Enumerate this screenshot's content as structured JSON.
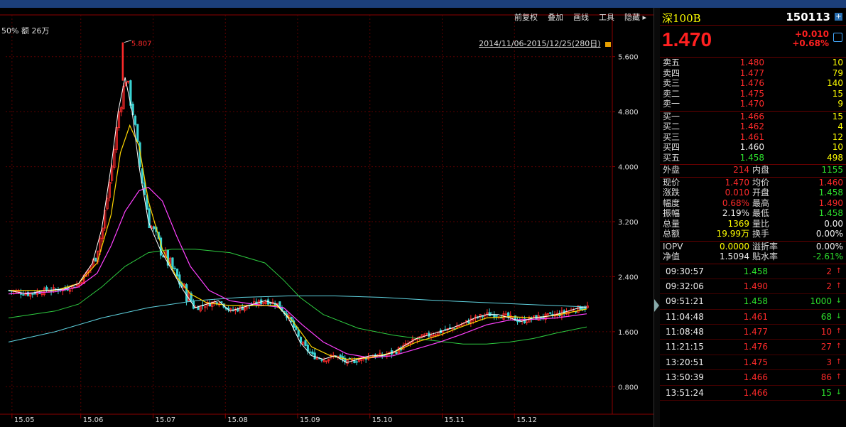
{
  "menu": [
    "前复权",
    "叠加",
    "画线",
    "工具",
    "隐藏 ▸"
  ],
  "info_bar": "50%  额 26万",
  "date_range": "2014/11/06-2015/12/25(280日)",
  "peak_label": "5.807",
  "colors": {
    "up": "#ff2a2a",
    "down": "#39d3d3",
    "ma5": "#ffffff",
    "ma10": "#ffd700",
    "ma20": "#ff40ff",
    "ma60": "#2ecc40",
    "ma120": "#5fd3e0"
  },
  "chart_data": {
    "type": "candlestick",
    "ylim": [
      0.4,
      6.0
    ],
    "y_ticks": [
      "5.600",
      "4.800",
      "4.000",
      "3.200",
      "2.400",
      "1.600",
      "0.800"
    ],
    "x_ticks": [
      "15.05",
      "15.06",
      "15.07",
      "15.08",
      "15.09",
      "15.10",
      "15.11",
      "15.12"
    ],
    "y_tick_values": [
      5.6,
      4.8,
      4.0,
      3.2,
      2.4,
      1.6,
      0.8
    ],
    "close_path": [
      [
        0,
        2.2
      ],
      [
        8,
        2.15
      ],
      [
        16,
        2.2
      ],
      [
        24,
        2.22
      ],
      [
        30,
        2.3
      ],
      [
        36,
        2.6
      ],
      [
        40,
        3.1
      ],
      [
        44,
        4.0
      ],
      [
        47,
        4.8
      ],
      [
        50,
        5.3
      ],
      [
        53,
        4.8
      ],
      [
        56,
        4.0
      ],
      [
        60,
        3.2
      ],
      [
        65,
        2.8
      ],
      [
        70,
        2.5
      ],
      [
        75,
        2.2
      ],
      [
        80,
        1.95
      ],
      [
        85,
        2.0
      ],
      [
        90,
        2.05
      ],
      [
        95,
        1.9
      ],
      [
        100,
        1.95
      ],
      [
        105,
        2.0
      ],
      [
        110,
        2.05
      ],
      [
        115,
        2.0
      ],
      [
        120,
        1.8
      ],
      [
        125,
        1.45
      ],
      [
        130,
        1.25
      ],
      [
        135,
        1.2
      ],
      [
        140,
        1.25
      ],
      [
        145,
        1.15
      ],
      [
        150,
        1.2
      ],
      [
        155,
        1.25
      ],
      [
        160,
        1.25
      ],
      [
        165,
        1.3
      ],
      [
        170,
        1.4
      ],
      [
        175,
        1.5
      ],
      [
        180,
        1.55
      ],
      [
        185,
        1.6
      ],
      [
        190,
        1.65
      ],
      [
        195,
        1.72
      ],
      [
        200,
        1.8
      ],
      [
        205,
        1.85
      ],
      [
        210,
        1.85
      ],
      [
        215,
        1.8
      ],
      [
        220,
        1.75
      ],
      [
        225,
        1.8
      ],
      [
        230,
        1.82
      ],
      [
        235,
        1.85
      ],
      [
        240,
        1.9
      ],
      [
        245,
        1.95
      ],
      [
        248,
        1.96
      ]
    ],
    "ma10_path": [
      [
        0,
        2.2
      ],
      [
        20,
        2.2
      ],
      [
        30,
        2.3
      ],
      [
        38,
        2.6
      ],
      [
        44,
        3.3
      ],
      [
        48,
        4.2
      ],
      [
        52,
        4.6
      ],
      [
        56,
        4.3
      ],
      [
        60,
        3.5
      ],
      [
        66,
        2.8
      ],
      [
        72,
        2.4
      ],
      [
        78,
        2.15
      ],
      [
        85,
        2.02
      ],
      [
        95,
        1.98
      ],
      [
        105,
        1.98
      ],
      [
        115,
        1.98
      ],
      [
        122,
        1.75
      ],
      [
        130,
        1.38
      ],
      [
        138,
        1.25
      ],
      [
        145,
        1.2
      ],
      [
        155,
        1.22
      ],
      [
        165,
        1.3
      ],
      [
        175,
        1.45
      ],
      [
        185,
        1.55
      ],
      [
        195,
        1.68
      ],
      [
        205,
        1.8
      ],
      [
        215,
        1.82
      ],
      [
        225,
        1.8
      ],
      [
        235,
        1.84
      ],
      [
        248,
        1.93
      ]
    ],
    "ma20_path": [
      [
        0,
        2.15
      ],
      [
        20,
        2.18
      ],
      [
        30,
        2.25
      ],
      [
        38,
        2.45
      ],
      [
        44,
        2.85
      ],
      [
        50,
        3.35
      ],
      [
        56,
        3.65
      ],
      [
        60,
        3.7
      ],
      [
        66,
        3.5
      ],
      [
        72,
        3.0
      ],
      [
        78,
        2.55
      ],
      [
        86,
        2.2
      ],
      [
        95,
        2.05
      ],
      [
        105,
        2.0
      ],
      [
        118,
        1.95
      ],
      [
        126,
        1.7
      ],
      [
        135,
        1.45
      ],
      [
        145,
        1.28
      ],
      [
        155,
        1.22
      ],
      [
        165,
        1.25
      ],
      [
        175,
        1.35
      ],
      [
        185,
        1.45
      ],
      [
        195,
        1.57
      ],
      [
        205,
        1.7
      ],
      [
        215,
        1.77
      ],
      [
        225,
        1.78
      ],
      [
        235,
        1.8
      ],
      [
        248,
        1.86
      ]
    ],
    "ma60_path": [
      [
        0,
        1.8
      ],
      [
        20,
        1.9
      ],
      [
        30,
        2.0
      ],
      [
        40,
        2.25
      ],
      [
        50,
        2.55
      ],
      [
        60,
        2.75
      ],
      [
        70,
        2.8
      ],
      [
        80,
        2.8
      ],
      [
        95,
        2.75
      ],
      [
        110,
        2.6
      ],
      [
        118,
        2.35
      ],
      [
        125,
        2.1
      ],
      [
        135,
        1.85
      ],
      [
        150,
        1.65
      ],
      [
        165,
        1.55
      ],
      [
        180,
        1.48
      ],
      [
        195,
        1.42
      ],
      [
        205,
        1.42
      ],
      [
        215,
        1.45
      ],
      [
        225,
        1.5
      ],
      [
        235,
        1.58
      ],
      [
        248,
        1.67
      ]
    ],
    "ma120_path": [
      [
        0,
        1.45
      ],
      [
        20,
        1.6
      ],
      [
        40,
        1.8
      ],
      [
        60,
        1.95
      ],
      [
        80,
        2.05
      ],
      [
        100,
        2.1
      ],
      [
        120,
        2.12
      ],
      [
        140,
        2.12
      ],
      [
        160,
        2.1
      ],
      [
        180,
        2.06
      ],
      [
        200,
        2.03
      ],
      [
        220,
        2.0
      ],
      [
        248,
        1.96
      ]
    ]
  },
  "panel": {
    "name": "深100B",
    "code": "150113",
    "plus": "+",
    "price": "1.470",
    "change": "+0.010",
    "change_pct": "+0.68%",
    "asks": [
      {
        "label": "卖五",
        "price": "1.480",
        "vol": "10"
      },
      {
        "label": "卖四",
        "price": "1.477",
        "vol": "79"
      },
      {
        "label": "卖三",
        "price": "1.476",
        "vol": "140"
      },
      {
        "label": "卖二",
        "price": "1.475",
        "vol": "15"
      },
      {
        "label": "卖一",
        "price": "1.470",
        "vol": "9"
      }
    ],
    "bids": [
      {
        "label": "买一",
        "price": "1.466",
        "vol": "15",
        "c": "red"
      },
      {
        "label": "买二",
        "price": "1.462",
        "vol": "4",
        "c": "red"
      },
      {
        "label": "买三",
        "price": "1.461",
        "vol": "12",
        "c": "red"
      },
      {
        "label": "买四",
        "price": "1.460",
        "vol": "10",
        "c": "white"
      },
      {
        "label": "买五",
        "price": "1.458",
        "vol": "498",
        "c": "green"
      }
    ],
    "outer": {
      "l1": "外盘",
      "v1": "214",
      "l2": "内盘",
      "v2": "1155"
    },
    "stats": [
      {
        "l1": "现价",
        "v1": "1.470",
        "c1": "red",
        "l2": "均价",
        "v2": "1.460",
        "c2": "red"
      },
      {
        "l1": "涨跌",
        "v1": "0.010",
        "c1": "red",
        "l2": "开盘",
        "v2": "1.458",
        "c2": "green"
      },
      {
        "l1": "幅度",
        "v1": "0.68%",
        "c1": "red",
        "l2": "最高",
        "v2": "1.490",
        "c2": "red"
      },
      {
        "l1": "振幅",
        "v1": "2.19%",
        "c1": "white",
        "l2": "最低",
        "v2": "1.458",
        "c2": "green"
      },
      {
        "l1": "总量",
        "v1": "1369",
        "c1": "yellow",
        "l2": "量比",
        "v2": "0.00",
        "c2": "white"
      },
      {
        "l1": "总额",
        "v1": "19.99万",
        "c1": "yellow",
        "l2": "换手",
        "v2": "0.00%",
        "c2": "white"
      }
    ],
    "iopv": [
      {
        "l1": "IOPV",
        "v1": "0.0000",
        "c1": "yellow",
        "l2": "溢折率",
        "v2": "0.00%",
        "c2": "white"
      },
      {
        "l1": "净值",
        "v1": "1.5094",
        "c1": "white",
        "l2": "贴水率",
        "v2": "-2.61%",
        "c2": "green"
      }
    ],
    "ticks": [
      {
        "t": "09:30:57",
        "p": "1.458",
        "pc": "green",
        "v": "2",
        "dir": "up"
      },
      {
        "t": "09:32:06",
        "p": "1.490",
        "pc": "red",
        "v": "2",
        "dir": "up"
      },
      {
        "t": "09:51:21",
        "p": "1.458",
        "pc": "green",
        "v": "1000",
        "dir": "down"
      },
      {
        "t": "11:04:48",
        "p": "1.461",
        "pc": "red",
        "v": "68",
        "dir": "down"
      },
      {
        "t": "11:08:48",
        "p": "1.477",
        "pc": "red",
        "v": "10",
        "dir": "up"
      },
      {
        "t": "11:21:15",
        "p": "1.476",
        "pc": "red",
        "v": "27",
        "dir": "up"
      },
      {
        "t": "13:20:51",
        "p": "1.475",
        "pc": "red",
        "v": "3",
        "dir": "up"
      },
      {
        "t": "13:50:39",
        "p": "1.466",
        "pc": "red",
        "v": "86",
        "dir": "up"
      },
      {
        "t": "13:51:24",
        "p": "1.466",
        "pc": "red",
        "v": "15",
        "dir": "down"
      }
    ]
  }
}
